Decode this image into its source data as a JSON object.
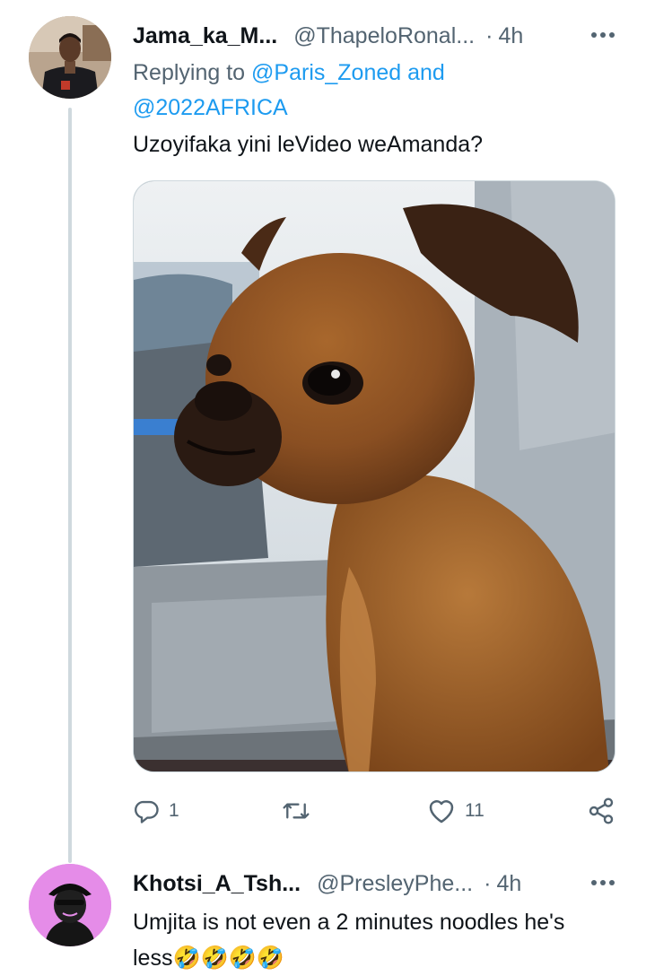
{
  "tweet1": {
    "display_name": "Jama_ka_M...",
    "handle": "@ThapeloRonal...",
    "separator": "·",
    "time": "4h",
    "replying_prefix": "Replying to ",
    "reply_user1": "@Paris_Zoned",
    "reply_and": " and",
    "reply_user2": "@2022AFRICA",
    "text": "Uzoyifaka yini leVideo weAmanda?",
    "media_subject": "brown small dog sitting in car seat",
    "actions": {
      "reply_count": "1",
      "retweet_count": "",
      "like_count": "11"
    }
  },
  "tweet2": {
    "display_name": "Khotsi_A_Tsh...",
    "handle": "@PresleyPhe...",
    "separator": "·",
    "time": "4h",
    "text_line1": "Umjita is not even a 2 minutes noodles he's",
    "text_line2": "less🤣🤣🤣🤣"
  },
  "icons": [
    "more-icon",
    "reply-icon",
    "retweet-icon",
    "like-icon",
    "share-icon"
  ],
  "colors": {
    "link": "#1d9bf0",
    "secondary_text": "#536471",
    "thread_line": "#cfd9de",
    "avatar2_bg": "#e58ce8"
  }
}
